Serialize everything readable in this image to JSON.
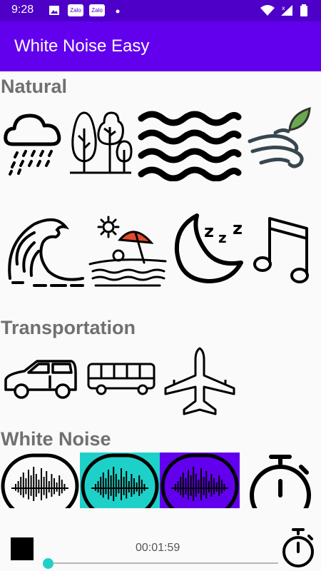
{
  "status_bar": {
    "time": "9:28",
    "notification_labels": [
      "Zalo",
      "Zalo"
    ]
  },
  "app_bar": {
    "title": "White Noise Easy"
  },
  "sections": {
    "natural": "Natural",
    "transportation": "Transportation",
    "white_noise": "White Noise"
  },
  "sounds": {
    "natural": [
      "rain-icon",
      "forest-icon",
      "waves-icon",
      "wind-icon",
      "ocean-wave-icon",
      "beach-icon",
      "sleep-moon-icon",
      "music-note-icon"
    ],
    "transportation": [
      "car-icon",
      "bus-icon",
      "airplane-icon"
    ],
    "white_noise": [
      "white-noise-icon",
      "white-noise-teal-icon",
      "white-noise-purple-icon",
      "timer-icon"
    ]
  },
  "player": {
    "elapsed": "00:01:59",
    "progress_fraction": 0.02
  },
  "colors": {
    "status_bar": "#4e00c8",
    "app_bar": "#6200ee",
    "section_text": "#707070",
    "teal_selected": "#1ed1c8",
    "purple_selected": "#6200ee"
  }
}
